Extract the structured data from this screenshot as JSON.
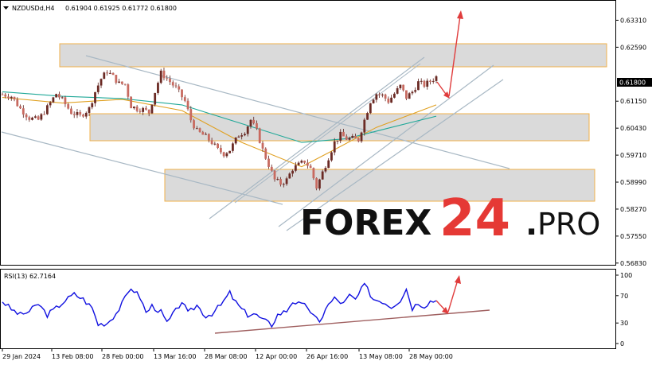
{
  "chart_data": [
    {
      "type": "candlestick",
      "title": "NZDUSDd,H4",
      "ohlc_text": "0.61904 0.61925 0.61772 0.61800",
      "current_price": "0.61800",
      "y_ticks": [
        "0.63310",
        "0.62590",
        "0.61800",
        "0.61150",
        "0.60430",
        "0.59710",
        "0.58990",
        "0.58270",
        "0.57550",
        "0.56830"
      ],
      "y_tick_values": [
        0.6331,
        0.6259,
        0.618,
        0.6115,
        0.6043,
        0.5971,
        0.5899,
        0.5827,
        0.5755,
        0.5683
      ],
      "ylim": [
        0.5672,
        0.6368
      ],
      "x_ticks": [
        "29 Jan 2024",
        "13 Feb 08:00",
        "28 Feb 00:00",
        "13 Mar 16:00",
        "28 Mar 08:00",
        "12 Apr 00:00",
        "26 Apr 16:00",
        "13 May 08:00",
        "28 May 00:00"
      ],
      "close_path": [
        [
          0,
          0.6133
        ],
        [
          3,
          0.6128
        ],
        [
          6,
          0.6095
        ],
        [
          9,
          0.607
        ],
        [
          12,
          0.6065
        ],
        [
          15,
          0.6098
        ],
        [
          18,
          0.6135
        ],
        [
          20,
          0.6118
        ],
        [
          23,
          0.6085
        ],
        [
          26,
          0.6075
        ],
        [
          29,
          0.6095
        ],
        [
          31,
          0.614
        ],
        [
          33,
          0.6175
        ],
        [
          35,
          0.6195
        ],
        [
          37,
          0.618
        ],
        [
          39,
          0.6162
        ],
        [
          41,
          0.616
        ],
        [
          43,
          0.6102
        ],
        [
          45,
          0.6095
        ],
        [
          47,
          0.6093
        ],
        [
          49,
          0.6085
        ],
        [
          51,
          0.614
        ],
        [
          53,
          0.619
        ],
        [
          55,
          0.6175
        ],
        [
          58,
          0.615
        ],
        [
          61,
          0.6115
        ],
        [
          63,
          0.6065
        ],
        [
          65,
          0.6035
        ],
        [
          68,
          0.602
        ],
        [
          70,
          0.6005
        ],
        [
          72,
          0.5985
        ],
        [
          74,
          0.5975
        ],
        [
          76,
          0.5985
        ],
        [
          79,
          0.6025
        ],
        [
          81,
          0.6035
        ],
        [
          83,
          0.6065
        ],
        [
          85,
          0.6035
        ],
        [
          87,
          0.5985
        ],
        [
          89,
          0.5945
        ],
        [
          91,
          0.5905
        ],
        [
          93,
          0.5895
        ],
        [
          95,
          0.5905
        ],
        [
          97,
          0.5935
        ],
        [
          99,
          0.5945
        ],
        [
          101,
          0.5955
        ],
        [
          103,
          0.5935
        ],
        [
          105,
          0.5885
        ],
        [
          107,
          0.5925
        ],
        [
          109,
          0.5965
        ],
        [
          111,
          0.6005
        ],
        [
          113,
          0.6025
        ],
        [
          115,
          0.6015
        ],
        [
          117,
          0.6015
        ],
        [
          119,
          0.6012
        ],
        [
          121,
          0.6065
        ],
        [
          123,
          0.6115
        ],
        [
          125,
          0.6135
        ],
        [
          127,
          0.613
        ],
        [
          129,
          0.6115
        ],
        [
          131,
          0.6135
        ],
        [
          133,
          0.6155
        ],
        [
          135,
          0.6125
        ],
        [
          137,
          0.614
        ],
        [
          139,
          0.6165
        ],
        [
          141,
          0.6158
        ],
        [
          143,
          0.6168
        ],
        [
          145,
          0.618
        ]
      ],
      "moving_averages": [
        {
          "color": "#e0a020",
          "path": [
            [
              0,
              0.6125
            ],
            [
              20,
              0.611
            ],
            [
              40,
              0.612
            ],
            [
              60,
              0.609
            ],
            [
              80,
              0.6005
            ],
            [
              100,
              0.594
            ],
            [
              112,
              0.599
            ],
            [
              125,
              0.6045
            ],
            [
              145,
              0.6105
            ]
          ]
        },
        {
          "color": "#20a898",
          "path": [
            [
              0,
              0.614
            ],
            [
              20,
              0.6128
            ],
            [
              40,
              0.6122
            ],
            [
              60,
              0.6105
            ],
            [
              80,
              0.6055
            ],
            [
              100,
              0.6005
            ],
            [
              115,
              0.6015
            ],
            [
              130,
              0.6045
            ],
            [
              145,
              0.6075
            ]
          ]
        }
      ],
      "rsi": {
        "label": "RSI(13) 62.7164",
        "y_ticks": [
          "100",
          "70",
          "30",
          "0"
        ],
        "levels": [
          100,
          70,
          30,
          0
        ],
        "ylim": [
          0,
          100
        ],
        "path": [
          [
            0,
            62
          ],
          [
            3,
            50
          ],
          [
            6,
            42
          ],
          [
            9,
            47
          ],
          [
            12,
            58
          ],
          [
            15,
            42
          ],
          [
            18,
            52
          ],
          [
            21,
            63
          ],
          [
            24,
            72
          ],
          [
            27,
            65
          ],
          [
            30,
            52
          ],
          [
            32,
            28
          ],
          [
            35,
            30
          ],
          [
            38,
            44
          ],
          [
            40,
            58
          ],
          [
            43,
            82
          ],
          [
            46,
            68
          ],
          [
            48,
            45
          ],
          [
            50,
            55
          ],
          [
            53,
            46
          ],
          [
            55,
            30
          ],
          [
            58,
            48
          ],
          [
            60,
            62
          ],
          [
            62,
            44
          ],
          [
            65,
            56
          ],
          [
            68,
            40
          ],
          [
            70,
            44
          ],
          [
            73,
            56
          ],
          [
            76,
            74
          ],
          [
            78,
            60
          ],
          [
            80,
            50
          ],
          [
            82,
            42
          ],
          [
            84,
            44
          ],
          [
            87,
            35
          ],
          [
            90,
            27
          ],
          [
            92,
            42
          ],
          [
            95,
            48
          ],
          [
            97,
            62
          ],
          [
            100,
            56
          ],
          [
            102,
            54
          ],
          [
            104,
            40
          ],
          [
            106,
            30
          ],
          [
            108,
            52
          ],
          [
            111,
            66
          ],
          [
            114,
            58
          ],
          [
            116,
            70
          ],
          [
            118,
            64
          ],
          [
            121,
            86
          ],
          [
            124,
            65
          ],
          [
            127,
            62
          ],
          [
            130,
            54
          ],
          [
            133,
            64
          ],
          [
            135,
            80
          ],
          [
            137,
            52
          ],
          [
            139,
            60
          ],
          [
            141,
            55
          ],
          [
            143,
            62
          ],
          [
            145,
            62.72
          ]
        ]
      }
    }
  ]
}
